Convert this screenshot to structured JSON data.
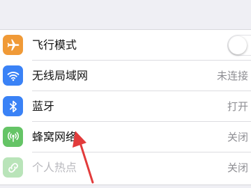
{
  "colors": {
    "airplane": "#f09a37",
    "wifi": "#3a82f6",
    "bluetooth": "#3a82f6",
    "cellular": "#65c466",
    "hotspot": "#65c466",
    "annotation_arrow": "#e23b3b"
  },
  "settings": {
    "rows": [
      {
        "label": "飞行模式",
        "value": "",
        "icon": "airplane-icon"
      },
      {
        "label": "无线局域网",
        "value": "未连接",
        "icon": "wifi-icon"
      },
      {
        "label": "蓝牙",
        "value": "打开",
        "icon": "bluetooth-icon"
      },
      {
        "label": "蜂窝网络",
        "value": "关闭",
        "icon": "cellular-icon"
      },
      {
        "label": "个人热点",
        "value": "关闭",
        "icon": "hotspot-icon"
      }
    ],
    "airplane_mode_on": false
  }
}
